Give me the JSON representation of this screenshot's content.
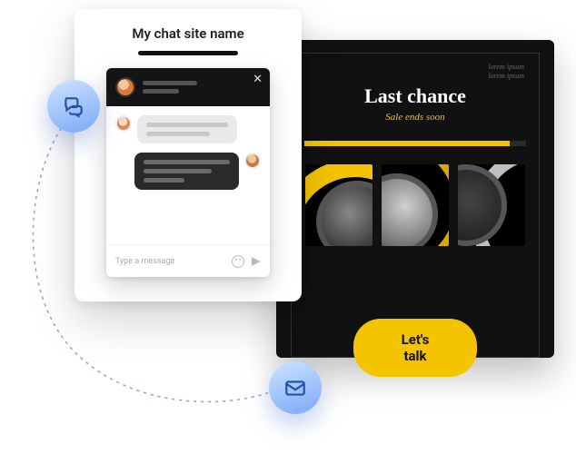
{
  "chat": {
    "site_name": "My chat site name",
    "input_placeholder": "Type a message"
  },
  "promo": {
    "meta_line1": "lorem ipsum",
    "meta_line2": "lorem ipsum",
    "title": "Last chance",
    "subtitle": "Sale ends soon",
    "cta_label": "Let's talk"
  },
  "colors": {
    "accent_yellow": "#f5c400",
    "badge_gradient_start": "#cfe4ff",
    "badge_gradient_end": "#7aa8f7"
  }
}
